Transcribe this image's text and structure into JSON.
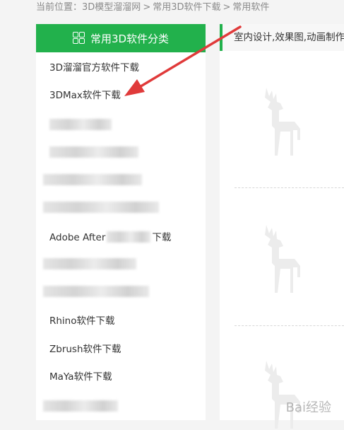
{
  "breadcrumb": {
    "prefix": "当前位置：",
    "crumbs": [
      "3D模型溜溜网",
      "常用3D软件下载",
      "常用软件"
    ],
    "separator": ">"
  },
  "sidebar": {
    "title": "常用3D软件分类",
    "items": [
      "3D溜溜官方软件下载",
      "3DMax软件下载",
      "Adobe After",
      "下载",
      "Rhino软件下载",
      "Zbrush软件下载",
      "MaYa软件下载"
    ]
  },
  "main": {
    "bar_text": "室内设计,效果图,动画制作"
  },
  "watermark": "Bai经验",
  "colors": {
    "accent": "#22b14c",
    "arrow": "#e03a3a"
  }
}
